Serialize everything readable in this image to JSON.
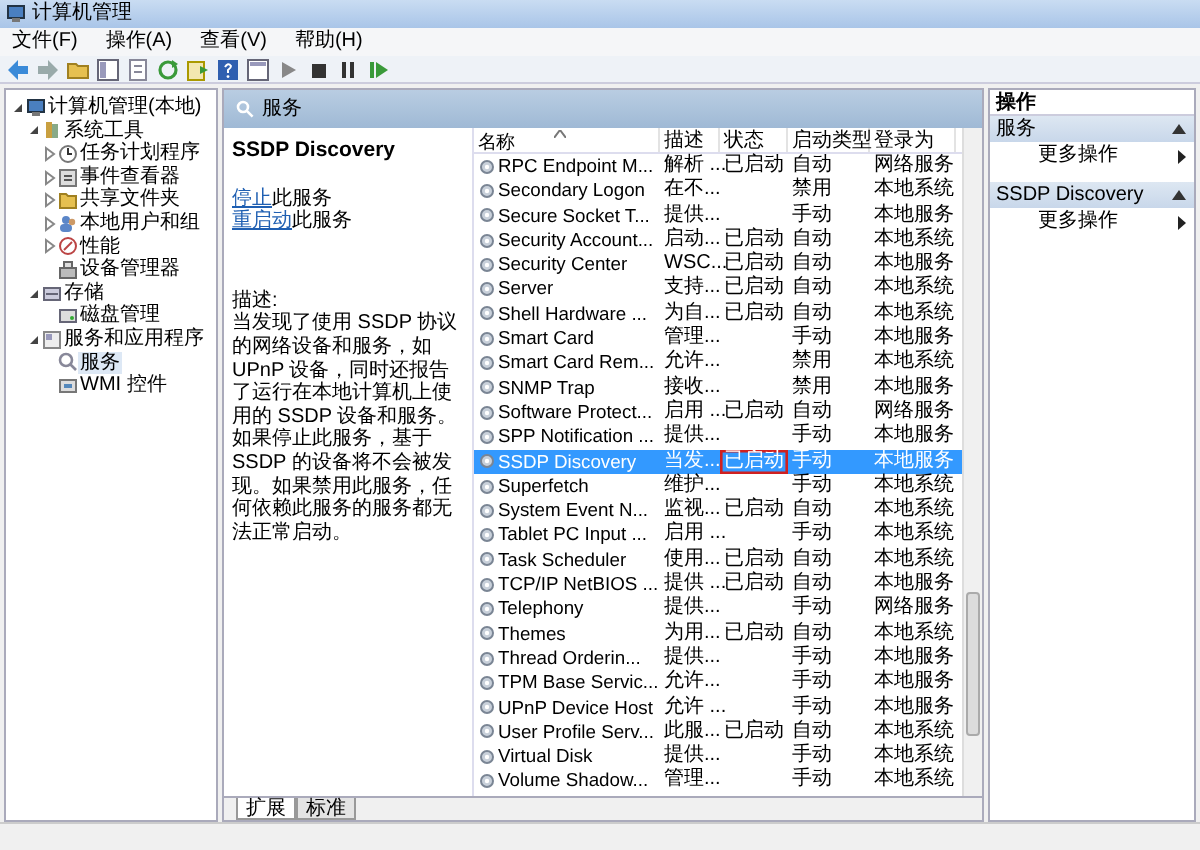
{
  "window": {
    "title": "计算机管理"
  },
  "menu": [
    "文件(F)",
    "操作(A)",
    "查看(V)",
    "帮助(H)"
  ],
  "tree": {
    "label": "计算机管理(本地)",
    "kind": "computer",
    "expanded": true,
    "selected": false,
    "children": [
      {
        "label": "系统工具",
        "kind": "tools",
        "expanded": true,
        "selected": false,
        "children": [
          {
            "label": "任务计划程序",
            "kind": "clock",
            "expanded": false,
            "selected": false
          },
          {
            "label": "事件查看器",
            "kind": "log",
            "expanded": false,
            "selected": false
          },
          {
            "label": "共享文件夹",
            "kind": "folder",
            "expanded": false,
            "selected": false
          },
          {
            "label": "本地用户和组",
            "kind": "users",
            "expanded": false,
            "selected": false
          },
          {
            "label": "性能",
            "kind": "perf",
            "expanded": false,
            "selected": false
          },
          {
            "label": "设备管理器",
            "kind": "device",
            "selected": false
          }
        ]
      },
      {
        "label": "存储",
        "kind": "storage",
        "expanded": true,
        "selected": false,
        "children": [
          {
            "label": "磁盘管理",
            "kind": "disk",
            "selected": false
          }
        ]
      },
      {
        "label": "服务和应用程序",
        "kind": "apps",
        "expanded": true,
        "selected": false,
        "children": [
          {
            "label": "服务",
            "kind": "services",
            "selected": true
          },
          {
            "label": "WMI 控件",
            "kind": "wmi",
            "selected": false
          }
        ]
      }
    ]
  },
  "center": {
    "header": "服务",
    "detail": {
      "title": "SSDP Discovery",
      "links": [
        {
          "link": "停止",
          "rest": "此服务"
        },
        {
          "link": "重启动",
          "rest": "此服务"
        }
      ],
      "desc_label": "描述:",
      "description": "当发现了使用 SSDP 协议的网络设备和服务，如 UPnP 设备，同时还报告了运行在本地计算机上使用的 SSDP 设备和服务。如果停止此服务，基于 SSDP 的设备将不会被发现。如果禁用此服务，任何依赖此服务的服务都无法正常启动。"
    },
    "table": {
      "columns": [
        "名称",
        "描述",
        "状态",
        "启动类型",
        "登录为"
      ],
      "rows": [
        {
          "name": "RPC Endpoint M...",
          "desc": "解析 ...",
          "status": "已启动",
          "startup": "自动",
          "logon": "网络服务",
          "selected": false,
          "annotated": false
        },
        {
          "name": "Secondary Logon",
          "desc": "在不...",
          "startup": "禁用",
          "logon": "本地系统",
          "selected": false,
          "annotated": false
        },
        {
          "name": "Secure Socket T...",
          "desc": "提供...",
          "startup": "手动",
          "logon": "本地服务",
          "selected": false,
          "annotated": false
        },
        {
          "name": "Security Account...",
          "desc": "启动...",
          "status": "已启动",
          "startup": "自动",
          "logon": "本地系统",
          "selected": false,
          "annotated": false
        },
        {
          "name": "Security Center",
          "desc": "WSC...",
          "status": "已启动",
          "startup": "自动",
          "logon": "本地服务",
          "selected": false,
          "annotated": false
        },
        {
          "name": "Server",
          "desc": "支持...",
          "status": "已启动",
          "startup": "自动",
          "logon": "本地系统",
          "selected": false,
          "annotated": false
        },
        {
          "name": "Shell Hardware ...",
          "desc": "为自...",
          "status": "已启动",
          "startup": "自动",
          "logon": "本地系统",
          "selected": false,
          "annotated": false
        },
        {
          "name": "Smart Card",
          "desc": "管理...",
          "startup": "手动",
          "logon": "本地服务",
          "selected": false,
          "annotated": false
        },
        {
          "name": "Smart Card Rem...",
          "desc": "允许...",
          "startup": "禁用",
          "logon": "本地系统",
          "selected": false,
          "annotated": false
        },
        {
          "name": "SNMP Trap",
          "desc": "接收...",
          "startup": "禁用",
          "logon": "本地服务",
          "selected": false,
          "annotated": false
        },
        {
          "name": "Software Protect...",
          "desc": "启用 ...",
          "status": "已启动",
          "startup": "自动",
          "logon": "网络服务",
          "selected": false,
          "annotated": false
        },
        {
          "name": "SPP Notification ...",
          "desc": "提供...",
          "startup": "手动",
          "logon": "本地服务",
          "selected": false,
          "annotated": false
        },
        {
          "name": "SSDP Discovery",
          "desc": "当发...",
          "status": "已启动",
          "startup": "手动",
          "logon": "本地服务",
          "selected": true,
          "annotated": true
        },
        {
          "name": "Superfetch",
          "desc": "维护...",
          "startup": "手动",
          "logon": "本地系统",
          "selected": false,
          "annotated": false
        },
        {
          "name": "System Event N...",
          "desc": "监视...",
          "status": "已启动",
          "startup": "自动",
          "logon": "本地系统",
          "selected": false,
          "annotated": false
        },
        {
          "name": "Tablet PC Input ...",
          "desc": "启用 ...",
          "startup": "手动",
          "logon": "本地系统",
          "selected": false,
          "annotated": false
        },
        {
          "name": "Task Scheduler",
          "desc": "使用...",
          "status": "已启动",
          "startup": "自动",
          "logon": "本地系统",
          "selected": false,
          "annotated": false
        },
        {
          "name": "TCP/IP NetBIOS ...",
          "desc": "提供 ...",
          "status": "已启动",
          "startup": "自动",
          "logon": "本地服务",
          "selected": false,
          "annotated": false
        },
        {
          "name": "Telephony",
          "desc": "提供...",
          "startup": "手动",
          "logon": "网络服务",
          "selected": false,
          "annotated": false
        },
        {
          "name": "Themes",
          "desc": "为用...",
          "status": "已启动",
          "startup": "自动",
          "logon": "本地系统",
          "selected": false,
          "annotated": false
        },
        {
          "name": "Thread Orderin...",
          "desc": "提供...",
          "startup": "手动",
          "logon": "本地服务",
          "selected": false,
          "annotated": false
        },
        {
          "name": "TPM Base Servic...",
          "desc": "允许...",
          "startup": "手动",
          "logon": "本地服务",
          "selected": false,
          "annotated": false
        },
        {
          "name": "UPnP Device Host",
          "desc": "允许 ...",
          "startup": "手动",
          "logon": "本地服务",
          "selected": false,
          "annotated": false
        },
        {
          "name": "User Profile Serv...",
          "desc": "此服...",
          "status": "已启动",
          "startup": "自动",
          "logon": "本地系统",
          "selected": false,
          "annotated": false
        },
        {
          "name": "Virtual Disk",
          "desc": "提供...",
          "startup": "手动",
          "logon": "本地系统",
          "selected": false,
          "annotated": false
        },
        {
          "name": "Volume Shadow...",
          "desc": "管理...",
          "startup": "手动",
          "logon": "本地系统",
          "selected": false,
          "annotated": false
        }
      ]
    },
    "tabs": [
      {
        "label": "扩展",
        "selected": true
      },
      {
        "label": "标准",
        "selected": false
      }
    ]
  },
  "actions": {
    "title": "操作",
    "groups": [
      {
        "title": "服务",
        "expanded": true,
        "items": [
          "更多操作"
        ]
      },
      {
        "title": "SSDP Discovery",
        "expanded": true,
        "items": [
          "更多操作"
        ]
      }
    ]
  }
}
